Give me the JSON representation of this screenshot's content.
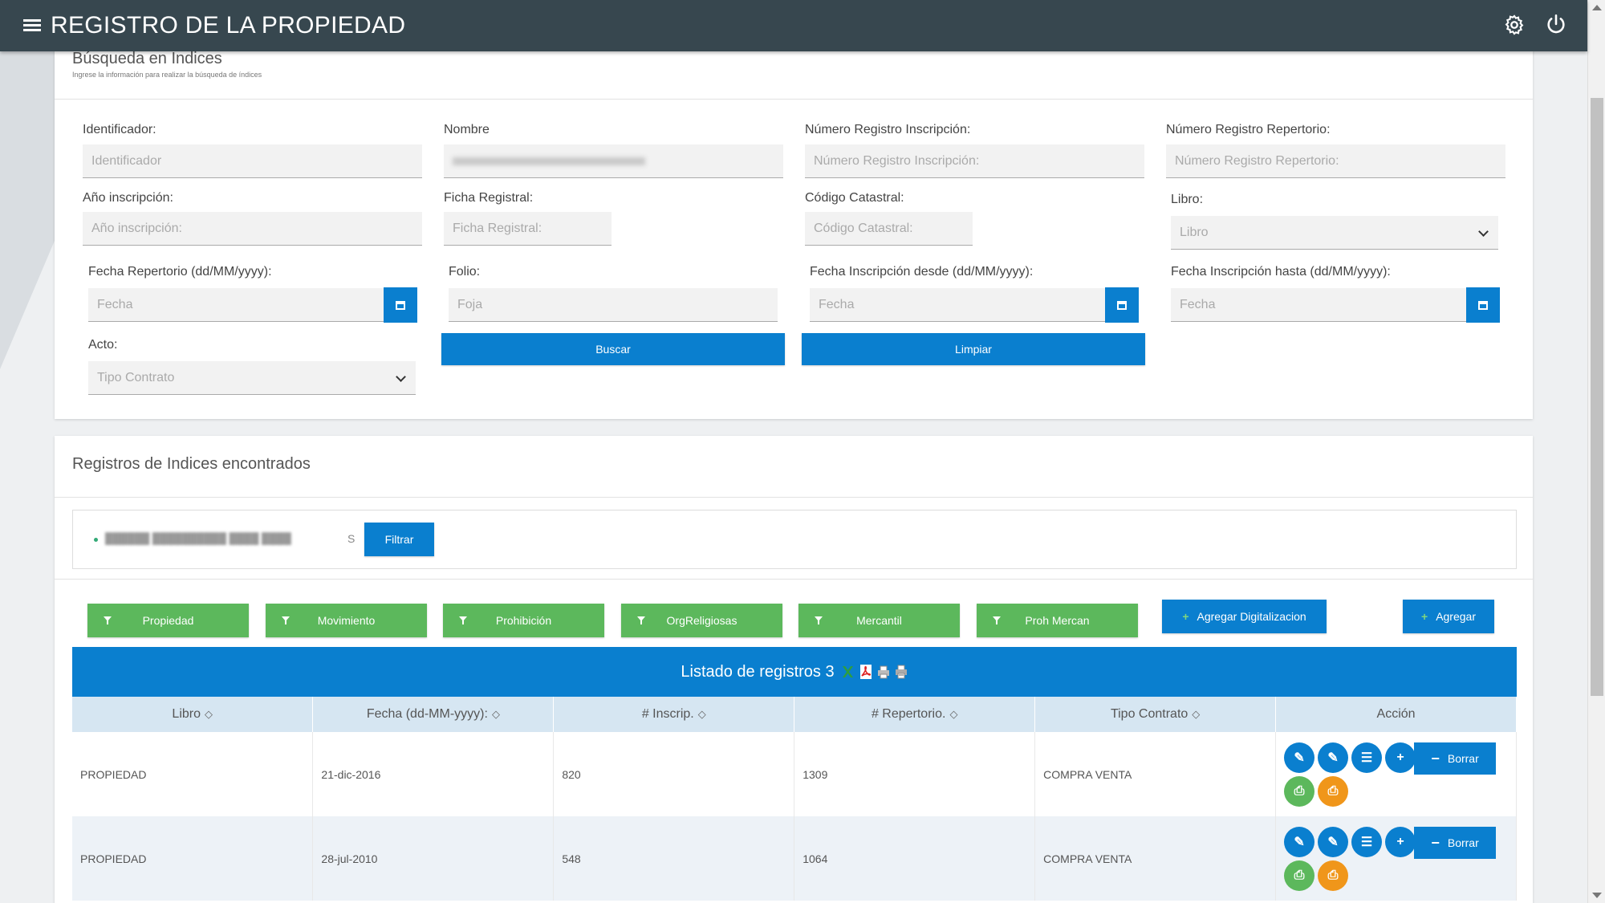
{
  "app": {
    "title": "REGISTRO DE LA PROPIEDAD"
  },
  "search": {
    "title": "Búsqueda en Índices",
    "subtitle": "Ingrese la información para realizar la búsqueda de índices",
    "fields": {
      "identificador": {
        "label": "Identificador:",
        "placeholder": "Identificador"
      },
      "nombre": {
        "label": "Nombre",
        "value": ""
      },
      "num_inscripcion": {
        "label": "Número Registro Inscripción:",
        "placeholder": "Número Registro Inscripción:"
      },
      "num_repertorio": {
        "label": "Número Registro Repertorio:",
        "placeholder": "Número Registro Repertorio:"
      },
      "anio": {
        "label": "Año inscripción:",
        "placeholder": "Año inscripción:"
      },
      "ficha": {
        "label": "Ficha Registral:",
        "placeholder": "Ficha Registral:"
      },
      "catastral": {
        "label": "Código Catastral:",
        "placeholder": "Código Catastral:"
      },
      "libro": {
        "label": "Libro:",
        "value": "Libro"
      },
      "fecha_repertorio": {
        "label": "Fecha Repertorio (dd/MM/yyyy):",
        "placeholder": "Fecha"
      },
      "folio": {
        "label": "Folio:",
        "placeholder": "Foja"
      },
      "fecha_desde": {
        "label": "Fecha Inscripción desde (dd/MM/yyyy):",
        "placeholder": "Fecha"
      },
      "fecha_hasta": {
        "label": "Fecha Inscripción hasta (dd/MM/yyyy):",
        "placeholder": "Fecha"
      },
      "acto": {
        "label": "Acto:",
        "value": "Tipo Contrato"
      }
    },
    "buttons": {
      "buscar": "Buscar",
      "limpiar": "Limpiar"
    }
  },
  "results": {
    "title": "Registros de Indices encontrados",
    "chip_text": "",
    "chip_tail": "S",
    "filtrar": "Filtrar",
    "filters": [
      "Propiedad",
      "Movimiento",
      "Prohibición",
      "OrgReligiosas",
      "Mercantil",
      "Proh Mercan"
    ],
    "agregar_digitalizacion": "Agregar Digitalizacion",
    "agregar": "Agregar",
    "list_title": "Listado de registros 3",
    "columns": [
      "Libro",
      "Fecha (dd-MM-yyyy):",
      "# Inscrip.",
      "# Repertorio.",
      "Tipo Contrato",
      "Acción"
    ],
    "rows": [
      [
        "PROPIEDAD",
        "21-dic-2016",
        "820",
        "1309",
        "COMPRA VENTA"
      ],
      [
        "PROPIEDAD",
        "28-jul-2010",
        "548",
        "1064",
        "COMPRA VENTA"
      ]
    ],
    "borrar": "Borrar",
    "export_icons": [
      "excel-icon",
      "pdf-icon",
      "print-icon",
      "print-all-icon"
    ]
  },
  "colors": {
    "topbar": "#37474f",
    "primary": "#0a7fcf",
    "success": "#5cb85c",
    "warning": "#f0961a"
  }
}
